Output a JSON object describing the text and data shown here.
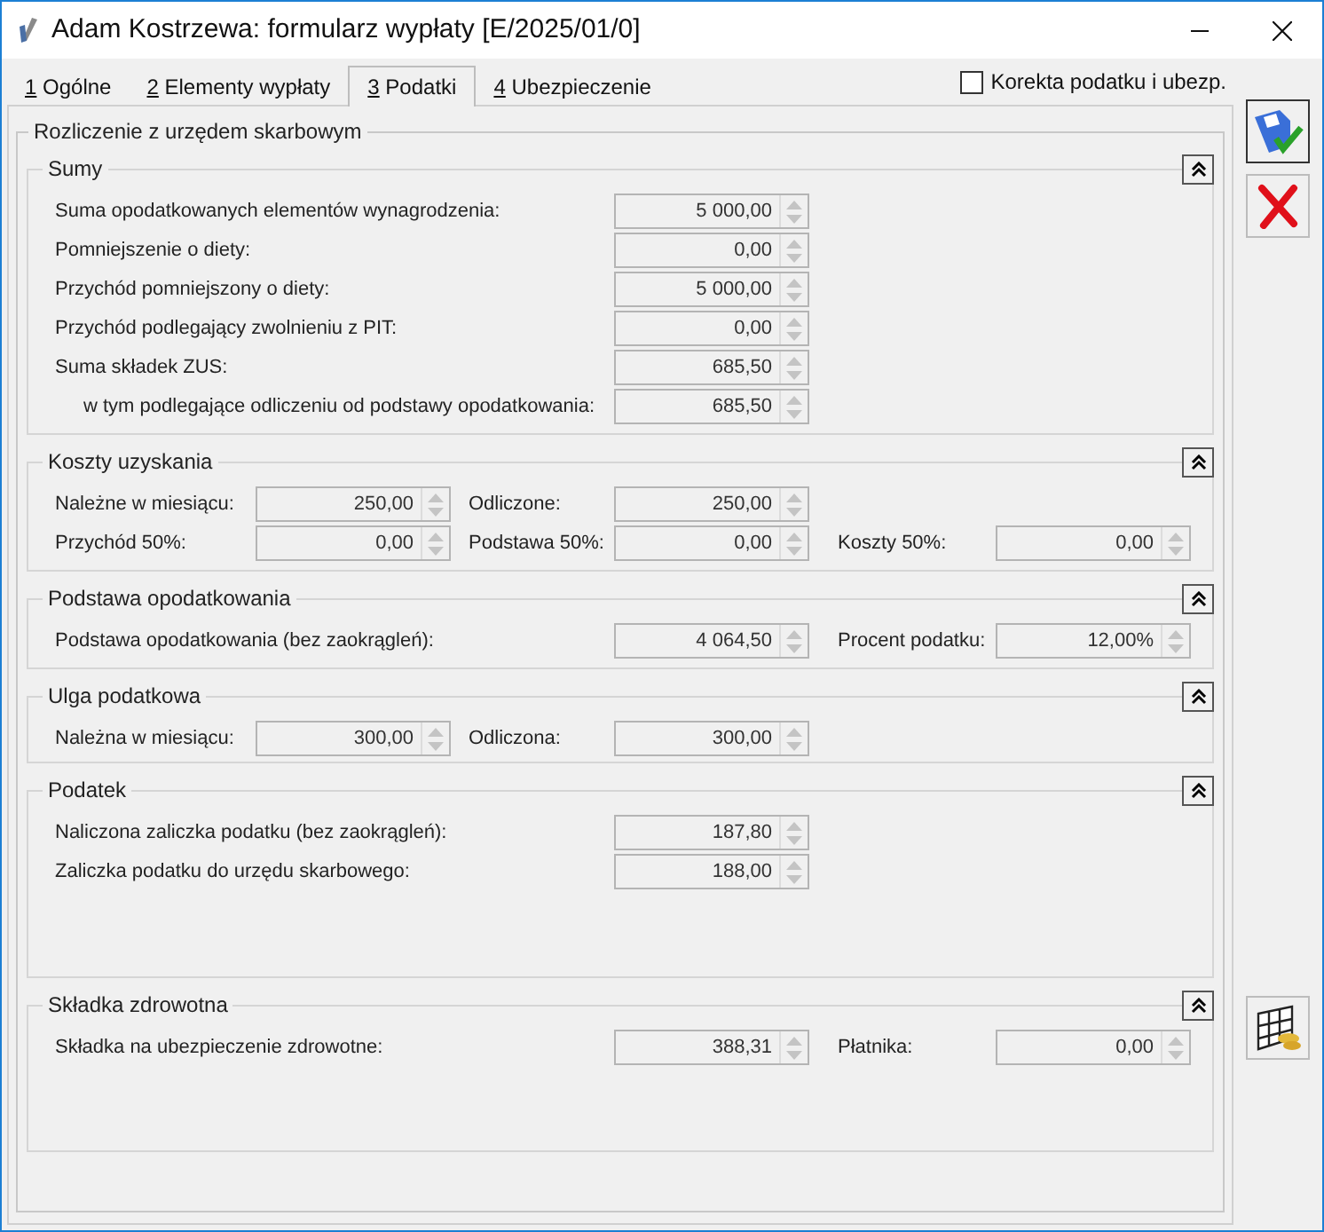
{
  "window": {
    "title": "Adam Kostrzewa: formularz wypłaty [E/2025/01/0]"
  },
  "tabs": [
    {
      "key": "1",
      "label": "Ogólne",
      "selected": false
    },
    {
      "key": "2",
      "label": "Elementy wypłaty",
      "selected": false
    },
    {
      "key": "3",
      "label": "Podatki",
      "selected": true
    },
    {
      "key": "4",
      "label": "Ubezpieczenie",
      "selected": false
    }
  ],
  "correction_checkbox": {
    "label": "Korekta podatku i ubezp.",
    "checked": false
  },
  "group": {
    "title": "Rozliczenie z urzędem skarbowym"
  },
  "sections": [
    {
      "title": "Sumy",
      "kind": "wide",
      "rows": [
        {
          "cells": [
            {
              "label": "Suma opodatkowanych elementów wynagrodzenia:",
              "value": "5 000,00"
            }
          ]
        },
        {
          "cells": [
            {
              "label": "Pomniejszenie o diety:",
              "value": "0,00"
            }
          ]
        },
        {
          "cells": [
            {
              "label": "Przychód pomniejszony o diety:",
              "value": "5 000,00"
            }
          ]
        },
        {
          "cells": [
            {
              "label": "Przychód podlegający zwolnieniu z PIT:",
              "value": "0,00"
            }
          ]
        },
        {
          "cells": [
            {
              "label": "Suma składek ZUS:",
              "value": "685,50"
            }
          ],
          "children": [
            {
              "cells": [
                {
                  "label": "w tym podlegające odliczeniu od podstawy opodatkowania:",
                  "value": "685,50"
                }
              ]
            }
          ]
        }
      ]
    },
    {
      "title": "Koszty uzyskania",
      "kind": "grid",
      "rows": [
        {
          "cells": [
            {
              "label": "Należne w miesiącu:",
              "value": "250,00"
            },
            {
              "label": "Odliczone:",
              "value": "250,00"
            }
          ]
        },
        {
          "cells": [
            {
              "label": "Przychód 50%:",
              "value": "0,00"
            },
            {
              "label": "Podstawa 50%:",
              "value": "0,00"
            },
            {
              "label": "Koszty 50%:",
              "value": "0,00"
            }
          ]
        }
      ]
    },
    {
      "title": "Podstawa opodatkowania",
      "kind": "wide",
      "rows": [
        {
          "cells": [
            {
              "label": "Podstawa opodatkowania (bez zaokrągleń):",
              "value": "4 064,50"
            },
            {
              "label": "Procent podatku:",
              "value": "12,00%"
            }
          ]
        }
      ]
    },
    {
      "title": "Ulga podatkowa",
      "kind": "grid",
      "rows": [
        {
          "cells": [
            {
              "label": "Należna w miesiącu:",
              "value": "300,00"
            },
            {
              "label": "Odliczona:",
              "value": "300,00"
            }
          ]
        }
      ]
    },
    {
      "title": "Podatek",
      "kind": "wide",
      "rows": [
        {
          "cells": [
            {
              "label": "Naliczona zaliczka podatku (bez zaokrągleń):",
              "value": "187,80"
            }
          ]
        },
        {
          "cells": [
            {
              "label": "Zaliczka podatku do urzędu skarbowego:",
              "value": "188,00"
            }
          ]
        }
      ]
    },
    {
      "title": "Składka zdrowotna",
      "kind": "wide",
      "rows": [
        {
          "cells": [
            {
              "label": "Składka na ubezpieczenie zdrowotne:",
              "value": "388,31"
            },
            {
              "label": "Płatnika:",
              "value": "0,00"
            }
          ]
        }
      ]
    }
  ]
}
